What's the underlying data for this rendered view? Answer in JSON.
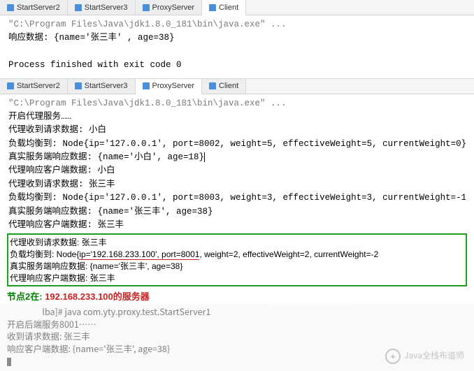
{
  "tabsTop": {
    "items": [
      {
        "label": "StartServer2",
        "active": false
      },
      {
        "label": "StartServer3",
        "active": false
      },
      {
        "label": "ProxyServer",
        "active": false
      },
      {
        "label": "Client",
        "active": true
      }
    ]
  },
  "consoleTop": {
    "cmd": "\"C:\\Program Files\\Java\\jdk1.8.0_181\\bin\\java.exe\" ...",
    "line1": "响应数据: {name='张三丰' , age=38}",
    "line2": "Process finished with exit code 0"
  },
  "tabsBottom": {
    "items": [
      {
        "label": "StartServer2",
        "active": false
      },
      {
        "label": "StartServer3",
        "active": false
      },
      {
        "label": "ProxyServer",
        "active": true
      },
      {
        "label": "Client",
        "active": false
      }
    ]
  },
  "consoleBottom": {
    "cmd": "\"C:\\Program Files\\Java\\jdk1.8.0_181\\bin\\java.exe\" ...",
    "l1": "开启代理服务……",
    "l2": "代理收到请求数据: 小白",
    "l3": "负载均衡到: Node{ip='127.0.0.1', port=8002, weight=5, effectiveWeight=5, currentWeight=0}",
    "l4": "真实服务端响应数据: {name='小白', age=18}",
    "l5": "代理响应客户端数据: 小白",
    "l6": "代理收到请求数据: 张三丰",
    "l7": "负载均衡到: Node{ip='127.0.0.1', port=8003, weight=3, effectiveWeight=3, currentWeight=-1}",
    "l8": "真实服务端响应数据: {name='张三丰', age=38}",
    "l9": "代理响应客户端数据: 张三丰"
  },
  "greenBox": {
    "g1": "代理收到请求数据: 张三丰",
    "g2a": "负载均衡到: Node{",
    "g2b": "ip='192.168.233.100', port=8001",
    "g2c": ", weight=2, effectiveWeight=2, currentWeight=-2",
    "g3": "真实服务端响应数据: {name='张三丰', age=38}",
    "g4": "代理响应客户端数据: 张三丰"
  },
  "footer": {
    "label": "节点2在: ",
    "ip": "192.168.233.100的服务器"
  },
  "terminal": {
    "t1": "                  lba]# java com.yty.proxy.test.StartServer1",
    "t2": "开启后端服务8001……",
    "t3": "收到请求数据: 张三丰",
    "t4": "响应客户端数据: {name='张三丰', age=38}"
  },
  "watermark": "Java全栈布道师"
}
